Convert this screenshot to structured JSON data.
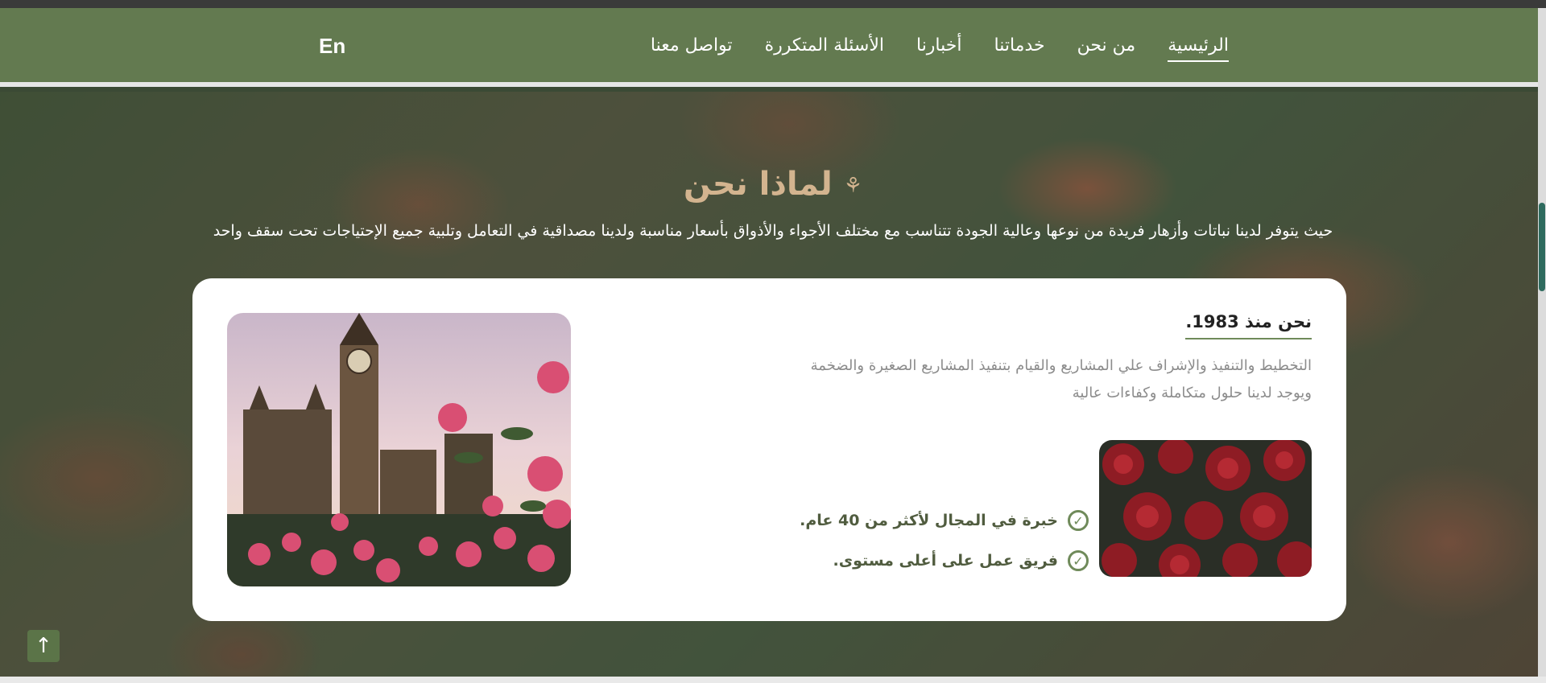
{
  "nav": {
    "items": [
      {
        "label": "الرئيسية",
        "active": true
      },
      {
        "label": "من نحن",
        "active": false
      },
      {
        "label": "خدماتنا",
        "active": false
      },
      {
        "label": "أخبارنا",
        "active": false
      },
      {
        "label": "الأسئلة المتكررة",
        "active": false
      },
      {
        "label": "تواصل معنا",
        "active": false
      }
    ],
    "lang": "En"
  },
  "section": {
    "title": "لماذا نحن",
    "subtitle": "حيث يتوفر لدينا نباتات وأزهار فريدة من نوعها وعالية الجودة تتناسب مع مختلف الأجواء والأذواق بأسعار مناسبة ولدينا مصداقية في التعامل وتلبية جميع الإحتياجات تحت سقف واحد"
  },
  "card": {
    "heading": "نحن منذ 1983.",
    "text_line1": "التخطيط والتنفيذ والإشراف علي المشاريع والقيام بتنفيذ المشاريع الصغيرة والضخمة",
    "text_line2": "ويوجد لدينا حلول متكاملة وكفاءات عالية",
    "features": [
      "خبرة في المجال لأكثر من 40 عام.",
      "فريق عمل على أعلى مستوى."
    ]
  },
  "colors": {
    "navbar": "#637a50",
    "title_gold": "#d3b48f",
    "accent_green": "#6f8a5a"
  }
}
